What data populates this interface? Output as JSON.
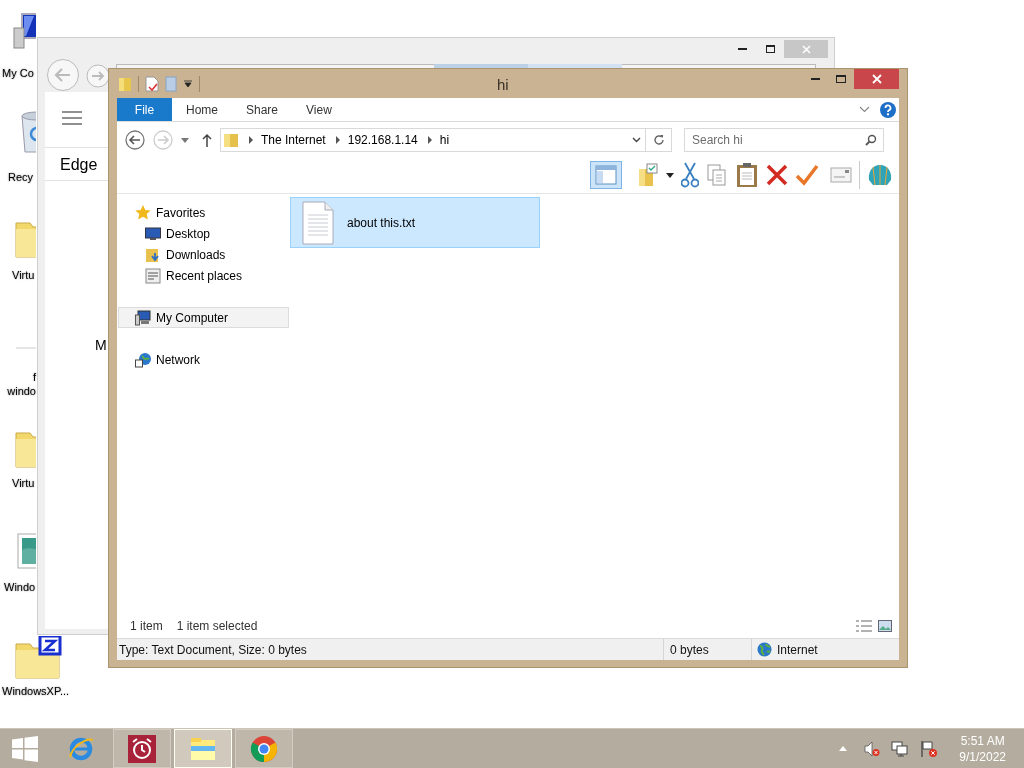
{
  "desktop_icons": [
    {
      "label": "My Co",
      "kind": "computer"
    },
    {
      "label": "Recy",
      "kind": "bin"
    },
    {
      "label": "Virtu",
      "kind": "folder"
    },
    {
      "label": "f windo",
      "kind": "blank"
    },
    {
      "label": "Virtu",
      "kind": "folder"
    },
    {
      "label": "Windo",
      "kind": "image"
    },
    {
      "label": "WindowsXP...",
      "kind": "zipfolder"
    }
  ],
  "back_window": {
    "menu_title": "Edge",
    "letter": "M"
  },
  "explorer": {
    "title": "hi",
    "ribbon_tabs": [
      {
        "label": "File",
        "selected": true
      },
      {
        "label": "Home",
        "selected": false
      },
      {
        "label": "Share",
        "selected": false
      },
      {
        "label": "View",
        "selected": false
      }
    ],
    "breadcrumb": [
      "The Internet",
      "192.168.1.14",
      "hi"
    ],
    "search": {
      "placeholder": "Search hi"
    },
    "nav": [
      {
        "label": "Favorites",
        "kind": "star",
        "selected": false,
        "children": [
          {
            "label": "Desktop",
            "kind": "desktop",
            "selected": false
          },
          {
            "label": "Downloads",
            "kind": "downloads",
            "selected": false
          },
          {
            "label": "Recent places",
            "kind": "recent",
            "selected": false
          }
        ]
      },
      {
        "label": "My Computer",
        "kind": "computer",
        "selected": true
      },
      {
        "label": "Network",
        "kind": "network",
        "selected": false
      }
    ],
    "files": [
      {
        "name": "about this.txt",
        "selected": true
      }
    ],
    "item_count": "1 item",
    "selection_count": "1 item selected",
    "status_bar": {
      "details": "Type: Text Document, Size: 0 bytes",
      "size": "0 bytes",
      "zone": "Internet"
    }
  },
  "taskbar": {
    "apps": [
      {
        "kind": "ie",
        "running": false,
        "selected": false
      },
      {
        "kind": "alarm",
        "running": true,
        "selected": false
      },
      {
        "kind": "explorer",
        "running": true,
        "selected": true
      },
      {
        "kind": "chrome",
        "running": true,
        "selected": false
      }
    ],
    "clock": {
      "time": "5:51 AM",
      "date": "9/1/2022"
    }
  }
}
